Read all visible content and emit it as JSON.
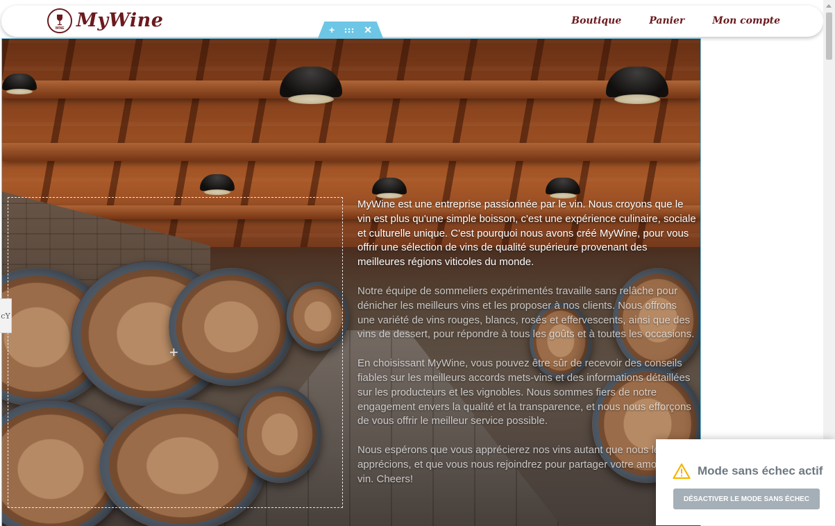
{
  "header": {
    "logo_badge_text": "WINE",
    "logo_text": "MyWine",
    "nav": [
      "Boutique",
      "Panier",
      "Mon compte"
    ],
    "accent_color": "#6b1a1e"
  },
  "editor": {
    "handle_icons": [
      "plus-icon",
      "drag-handle-icon",
      "close-icon"
    ],
    "handle_color": "#6ec6e6"
  },
  "edge_tab": {
    "text": "cY"
  },
  "content": {
    "paragraphs": [
      "MyWine est une entreprise passionnée par le vin. Nous croyons que le vin est plus qu'une simple boisson, c'est une expérience culinaire, sociale et culturelle unique. C'est pourquoi nous avons créé MyWine, pour vous offrir une sélection de vins de qualité supérieure provenant des meilleures régions viticoles du monde.",
      "Notre équipe de sommeliers expérimentés travaille sans relâche pour dénicher les meilleurs vins et les proposer à nos clients. Nous offrons une variété de vins rouges, blancs, rosés et effervescents, ainsi que des vins de dessert, pour répondre à tous les goûts et à toutes les occasions.",
      "En choisissant MyWine, vous pouvez être sûr de recevoir des conseils fiables sur les meilleurs accords mets-vins et des informations détaillées sur les producteurs et les vignobles. Nous sommes fiers de notre engagement envers la qualité et la transparence, et nous nous efforçons de vous offrir le meilleur service possible.",
      "Nous espérons que vous apprécierez nos vins autant que nous les apprécions, et que vous nous rejoindrez pour partager votre amour du vin. Cheers!"
    ]
  },
  "safe_mode": {
    "title": "Mode sans échec actif",
    "button_label": "DÉSACTIVER LE MODE SANS ÉCHEC",
    "icon": "warning-icon",
    "warning_color": "#f5b400"
  }
}
